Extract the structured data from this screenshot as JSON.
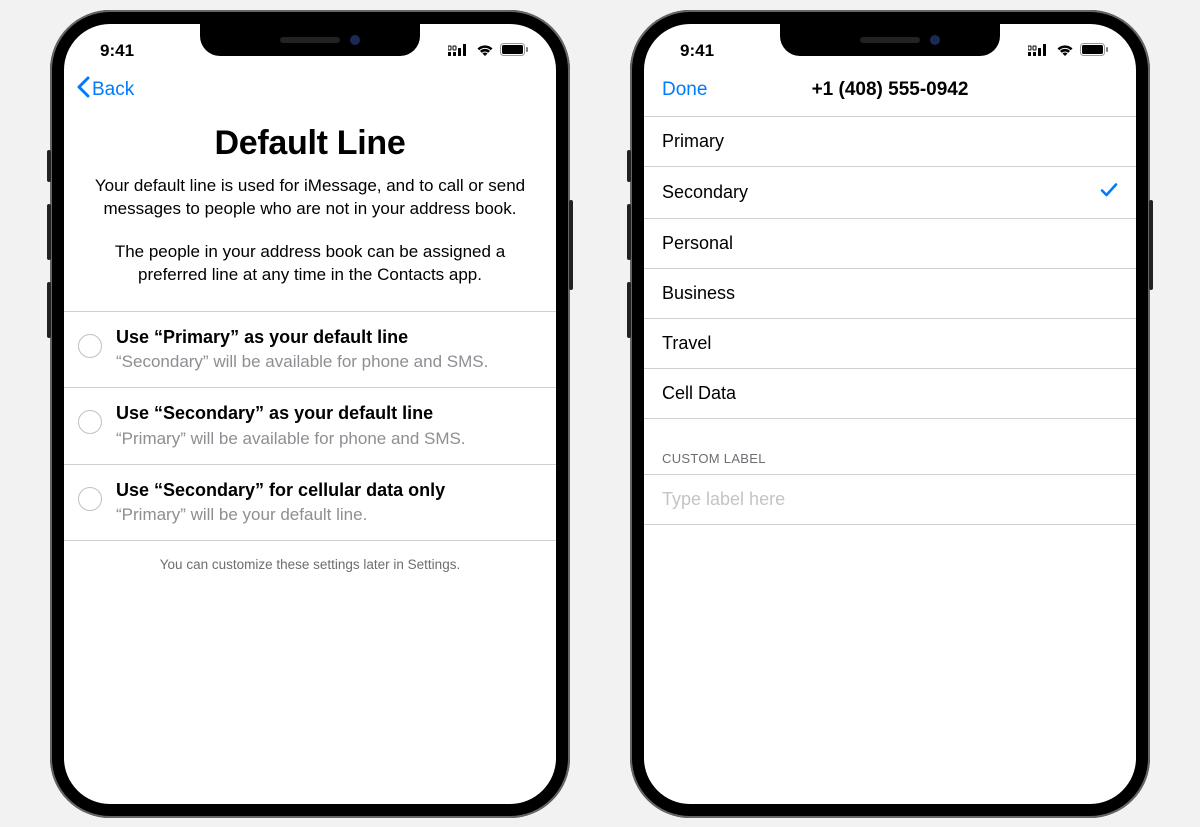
{
  "status": {
    "time": "9:41"
  },
  "left": {
    "back": "Back",
    "title": "Default Line",
    "description1": "Your default line is used for iMessage, and to call or send messages to people who are not in your address book.",
    "description2": "The people in your address book can be assigned a preferred line at any time in the Contacts app.",
    "options": [
      {
        "title": "Use “Primary” as your default line",
        "sub": "“Secondary” will be available for phone and SMS."
      },
      {
        "title": "Use “Secondary” as your default line",
        "sub": "“Primary” will be available for phone and SMS."
      },
      {
        "title": "Use “Secondary” for cellular data only",
        "sub": "“Primary” will be your default line."
      }
    ],
    "footnote": "You can customize these settings later in Settings."
  },
  "right": {
    "done": "Done",
    "title": "+1 (408) 555-0942",
    "labels": [
      {
        "text": "Primary",
        "selected": false
      },
      {
        "text": "Secondary",
        "selected": true
      },
      {
        "text": "Personal",
        "selected": false
      },
      {
        "text": "Business",
        "selected": false
      },
      {
        "text": "Travel",
        "selected": false
      },
      {
        "text": "Cell Data",
        "selected": false
      }
    ],
    "customSection": "CUSTOM LABEL",
    "customPlaceholder": "Type label here"
  }
}
